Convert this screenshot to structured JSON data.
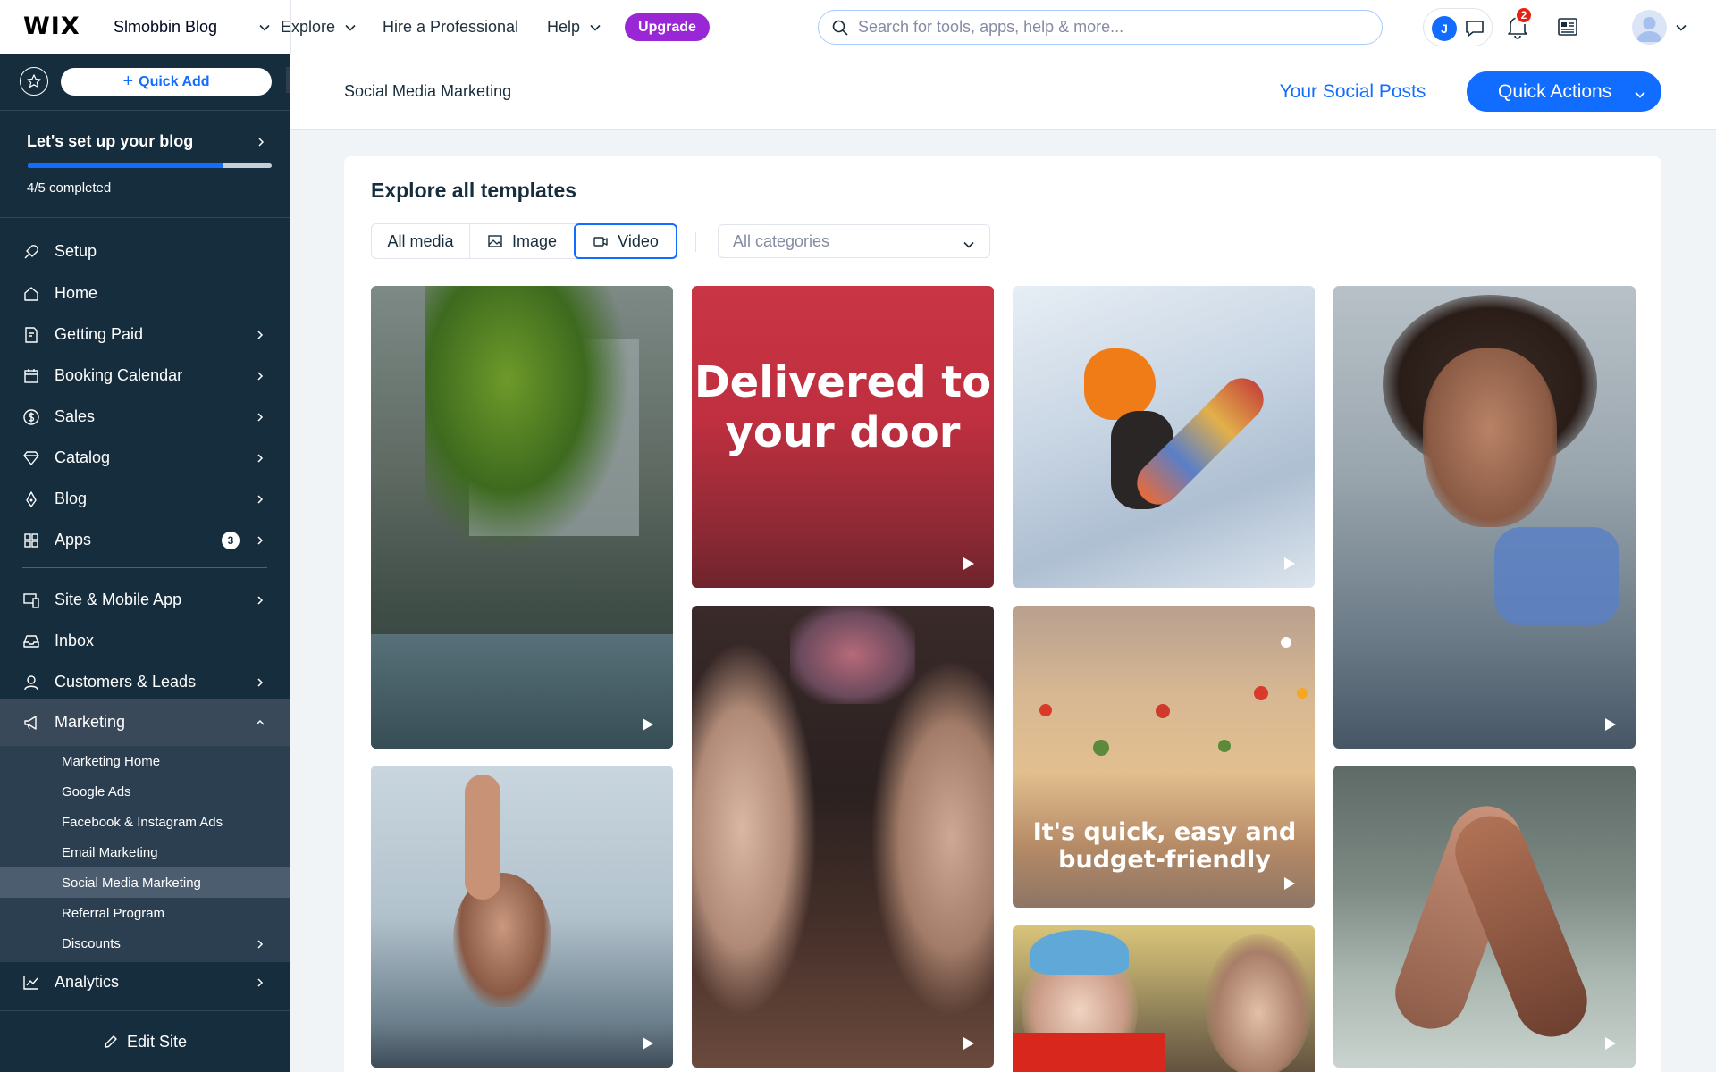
{
  "app": {
    "logo": "WIX",
    "site_name": "Slmobbin Blog"
  },
  "topnav": {
    "explore": "Explore",
    "hire": "Hire a Professional",
    "help": "Help",
    "upgrade": "Upgrade",
    "search_placeholder": "Search for tools, apps, help & more...",
    "user_initial": "J",
    "notification_count": "2"
  },
  "sidebar": {
    "quick_add": "Quick Add",
    "setup_title": "Let's set up your blog",
    "progress_text": "4/5 completed",
    "progress_fraction": 0.8,
    "items": [
      {
        "label": "Setup",
        "icon": "rocket-icon"
      },
      {
        "label": "Home",
        "icon": "home-icon"
      },
      {
        "label": "Getting Paid",
        "icon": "getting-paid-icon"
      },
      {
        "label": "Booking Calendar",
        "icon": "calendar-icon"
      },
      {
        "label": "Sales",
        "icon": "dollar-icon"
      },
      {
        "label": "Catalog",
        "icon": "catalog-icon"
      },
      {
        "label": "Blog",
        "icon": "pen-nib-icon"
      },
      {
        "label": "Apps",
        "icon": "apps-icon",
        "count": "3"
      },
      {
        "label": "Site & Mobile App",
        "icon": "devices-icon"
      },
      {
        "label": "Inbox",
        "icon": "inbox-icon"
      },
      {
        "label": "Customers & Leads",
        "icon": "customers-icon"
      },
      {
        "label": "Marketing",
        "icon": "megaphone-icon"
      },
      {
        "label": "Analytics",
        "icon": "analytics-icon"
      }
    ],
    "marketing_sub": [
      "Marketing Home",
      "Google Ads",
      "Facebook & Instagram Ads",
      "Email Marketing",
      "Social Media Marketing",
      "Referral Program",
      "Discounts"
    ],
    "edit_site": "Edit Site"
  },
  "header": {
    "breadcrumb": "Social Media Marketing",
    "your_social_posts": "Your Social Posts",
    "quick_actions": "Quick Actions"
  },
  "templates": {
    "title": "Explore all templates",
    "tabs": [
      "All media",
      "Image",
      "Video"
    ],
    "selected_tab": "Video",
    "categories_placeholder": "All categories",
    "tiles": [
      {
        "caption": ""
      },
      {
        "caption": "Delivered to your door"
      },
      {
        "caption": ""
      },
      {
        "caption": ""
      },
      {
        "caption": ""
      },
      {
        "caption": ""
      },
      {
        "caption": "It's quick, easy and budget-friendly"
      },
      {
        "caption": ""
      },
      {
        "caption": ""
      }
    ]
  },
  "colors": {
    "accent": "#116dff",
    "sidebar_bg": "#162d3d",
    "upgrade": "#9a27d5",
    "badge": "#e62214",
    "template_red": "#c93544"
  }
}
